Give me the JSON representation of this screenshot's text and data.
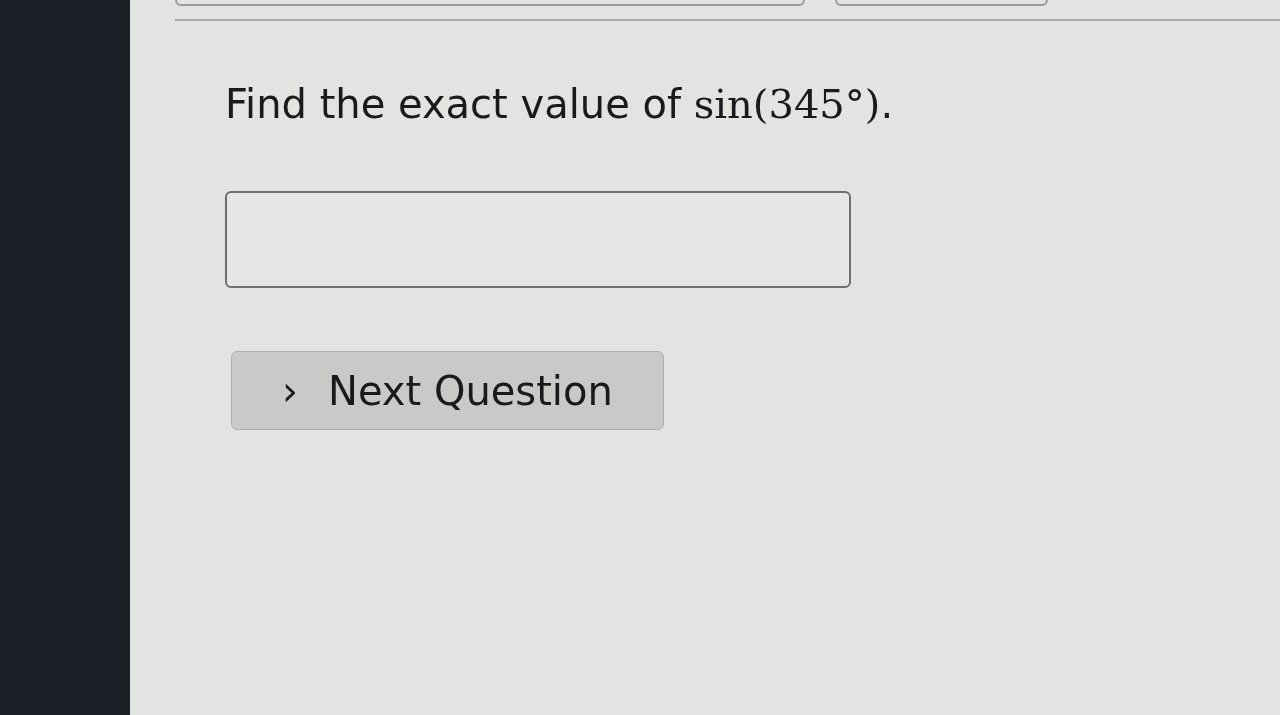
{
  "question": {
    "text": "Find the exact value of ",
    "math": "sin(345°)",
    "end": "."
  },
  "next_button": {
    "chevron": "›",
    "label": "Next Question"
  }
}
